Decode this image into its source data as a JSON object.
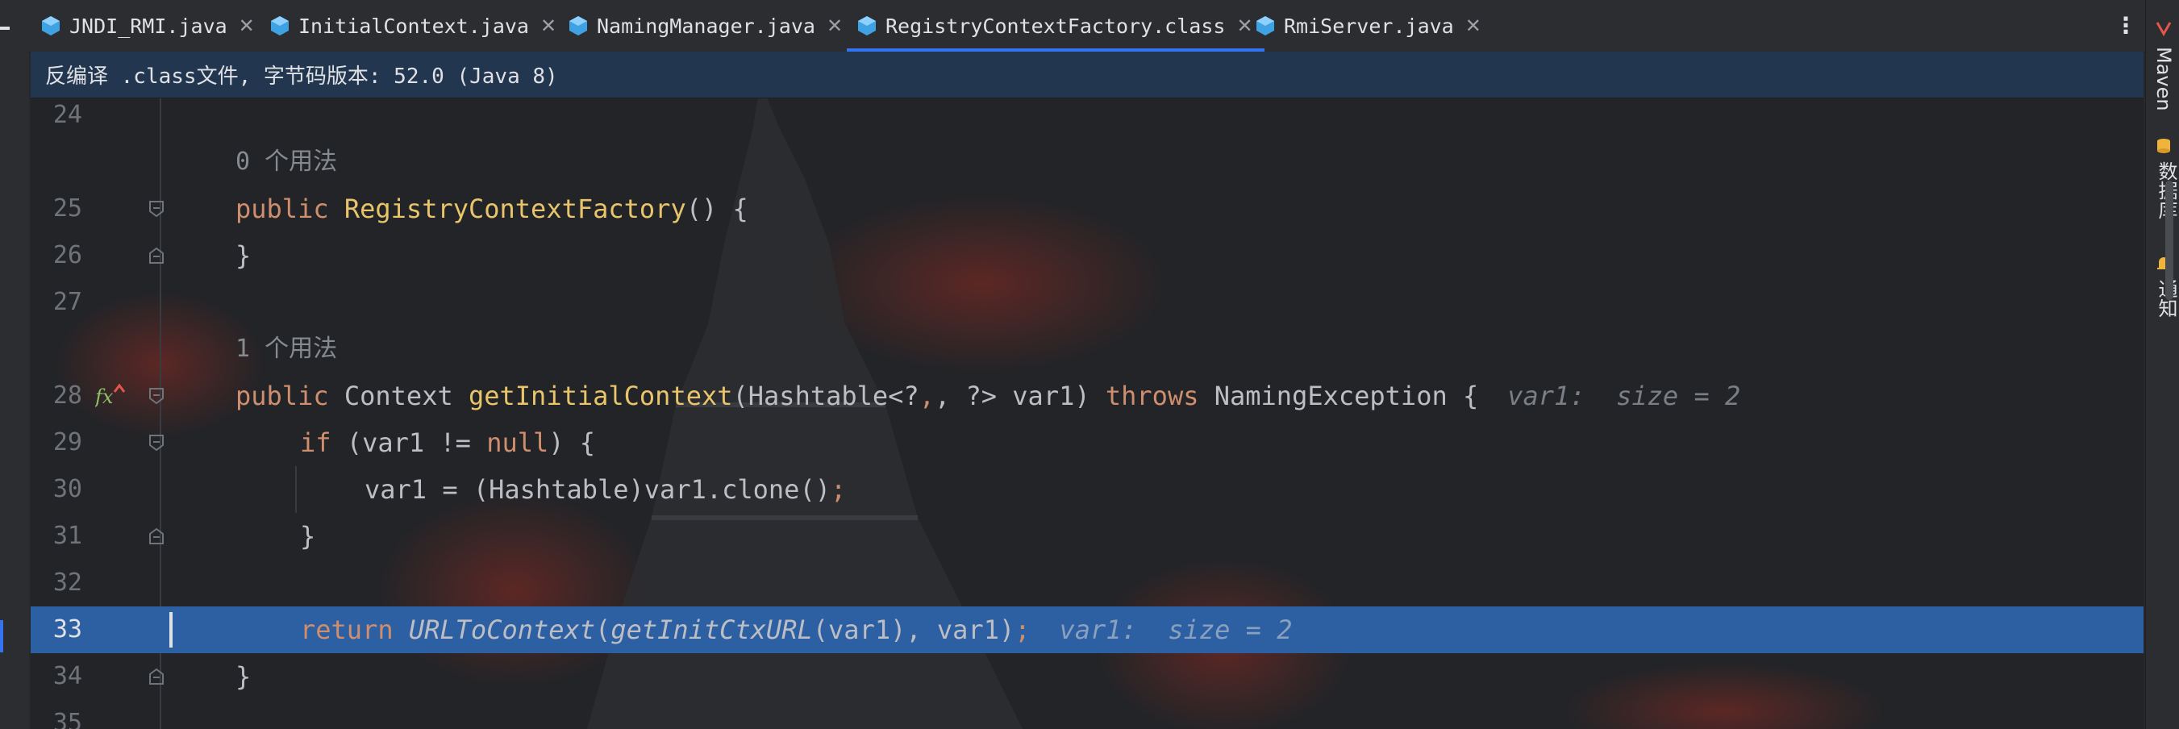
{
  "tabs": [
    {
      "label": "JNDI_RMI.java",
      "icon": "java-class-icon"
    },
    {
      "label": "InitialContext.java",
      "icon": "java-class-icon"
    },
    {
      "label": "NamingManager.java",
      "icon": "java-class-icon"
    },
    {
      "label": "RegistryContextFactory.class",
      "icon": "java-class-icon",
      "active": true
    },
    {
      "label": "RmiServer.java",
      "icon": "java-class-icon"
    }
  ],
  "banner": {
    "text": "反编译 .class文件, 字节码版本: 52.0 (Java 8)"
  },
  "right_strip": {
    "maven": "Maven",
    "database": "数据库",
    "notifications": "通知"
  },
  "editor": {
    "line_numbers": [
      "24",
      "25",
      "26",
      "27",
      "28",
      "29",
      "30",
      "31",
      "32",
      "33",
      "34",
      "35"
    ],
    "usage_hint_1": "0 个用法",
    "usage_hint_2": "1 个用法",
    "line25": {
      "kw": "public",
      "name": "RegistryContextFactory",
      "rest": "() {"
    },
    "line26": "}",
    "line28": {
      "kw": "public",
      "type": "Context",
      "name": "getInitialContext",
      "params": "(Hashtable<?",
      "params2": ", ?> var1) ",
      "throws": "throws",
      "exc": " NamingException {",
      "inlay": "var1:  size = 2"
    },
    "line29": {
      "kw": "if",
      "mid": " (var1 != ",
      "null": "null",
      "end": ") {"
    },
    "line30": {
      "code": "var1 = (Hashtable)var1.clone()",
      "semi": ";"
    },
    "line31": "}",
    "line33": {
      "kw": "return",
      "fn1": "URLToContext",
      "p1": "(",
      "fn2": "getInitCtxURL",
      "args": "(var1), var1)",
      "semi": ";",
      "inlay": "var1:  size = 2"
    },
    "line34": "}"
  },
  "colors": {
    "accent": "#3574f0",
    "highlight": "#2d5fa3",
    "keyword": "#cf8e6d",
    "method": "#e8c46a"
  }
}
